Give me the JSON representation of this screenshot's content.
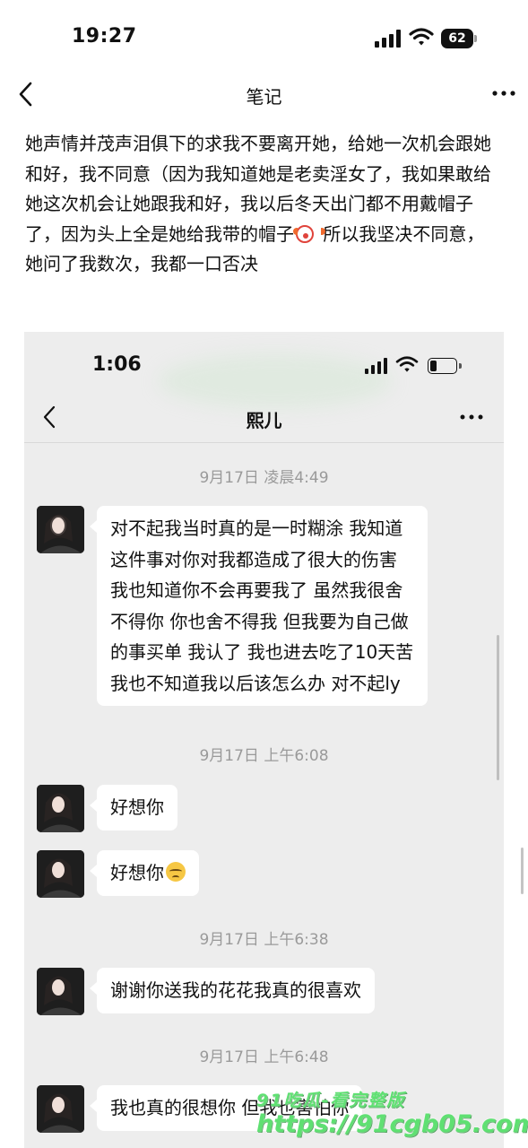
{
  "status_bar": {
    "time": "19:27",
    "battery": "62"
  },
  "nav": {
    "title": "笔记"
  },
  "note": {
    "text_before_emoji": "她声情并茂声泪俱下的求我不要离开她，给她一次机会跟她和好，我不同意（因为我知道她是老卖淫女了，我如果敢给她这次机会让她跟我和好，我以后冬天出门都不用戴帽子了，因为头上全是她给我带的帽子",
    "emoji": "clown-face",
    "text_after_emoji": " 所以我坚决不同意，她问了我数次，我都一口否决"
  },
  "screenshot": {
    "status_time": "1:06",
    "chat_title": "熙儿",
    "messages": [
      {
        "timestamp": "9月17日 凌晨4:49",
        "text": "对不起我当时真的是一时糊涂 我知道这件事对你对我都造成了很大的伤害 我也知道你不会再要我了 虽然我很舍不得你 你也舍不得我 但我要为自己做的事买单 我认了 我也进去吃了10天苦 我也不知道我以后该怎么办 对不起ly"
      },
      {
        "timestamp": "9月17日 上午6:08",
        "text": "好想你"
      },
      {
        "timestamp": "",
        "text": "好想你",
        "emoji": "pensive-face"
      },
      {
        "timestamp": "9月17日 上午6:38",
        "text": "谢谢你送我的花花我真的很喜欢"
      },
      {
        "timestamp": "9月17日 上午6:48",
        "text": "我也真的很想你 但我也害怕你"
      }
    ]
  },
  "watermark": {
    "line1": "91吃瓜-看完整版",
    "line2": "https://91cgb05.com"
  }
}
